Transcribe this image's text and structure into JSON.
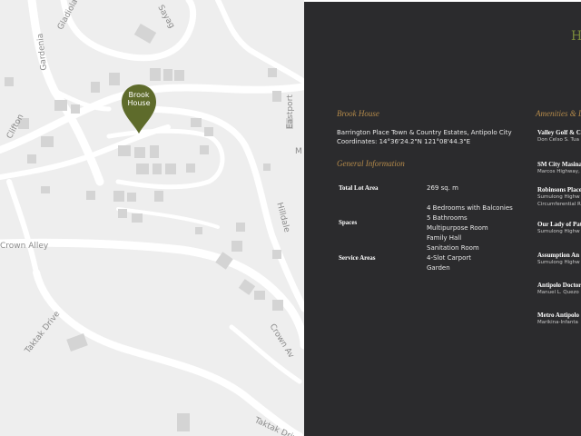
{
  "map": {
    "pin_label_line1": "Brook",
    "pin_label_line2": "House",
    "pin_color": "#5e6b2b",
    "roads": {
      "gladiola": "Gladiola",
      "gardenia": "Gardenia",
      "clifton": "Clifton",
      "eastport": "Eastport",
      "hilldale": "Hilldale",
      "crown_alley": "Crown Alley",
      "crown_av": "Crown Av",
      "taktak_drive": "Taktak Drive",
      "taktak_drive_2": "Taktak Drive",
      "sayag": "Sayag",
      "m_fragment": "M"
    }
  },
  "info": {
    "brand_glyph": "H",
    "accent_color": "#b48a4a",
    "brook_house": {
      "heading": "Brook House",
      "address_line1": "Barrington Place Town & Country Estates, Antipolo City",
      "address_line2": "Coordinates: 14°36'24.2\"N 121°08'44.3\"E"
    },
    "general_information": {
      "heading": "General Information",
      "total_lot_area_label": "Total Lot Area",
      "total_lot_area_value": "269 sq. m",
      "spaces_label": "Spaces",
      "spaces_values": [
        "4 Bedrooms with Balconies",
        "5 Bathrooms",
        "Multipurpose Room",
        "Family Hall"
      ],
      "service_areas_label": "Service Areas",
      "service_areas_values": [
        "Sanitation Room",
        "4-Slot Carport",
        "Garden"
      ]
    },
    "amenities": {
      "heading": "Amenities & D",
      "items": [
        {
          "name": "Valley Golf & Co",
          "address1": "Don Celso S. Tua",
          "address2": ""
        },
        {
          "name": "SM City Masina",
          "address1": "Marcos Highway,",
          "address2": ""
        },
        {
          "name": "Robinsons Place",
          "address1": "Sumulong Highw",
          "address2": "Circumferential R"
        },
        {
          "name": "Our Lady of Pat",
          "address1": "Sumulong Highw",
          "address2": ""
        },
        {
          "name": "Assumption An",
          "address1": "Sumulong Highw",
          "address2": ""
        },
        {
          "name": "Antipolo Doctor",
          "address1": "Manuel L. Quezo",
          "address2": ""
        },
        {
          "name": "Metro Antipolo",
          "address1": "Marikina-Infanta",
          "address2": ""
        }
      ]
    }
  }
}
